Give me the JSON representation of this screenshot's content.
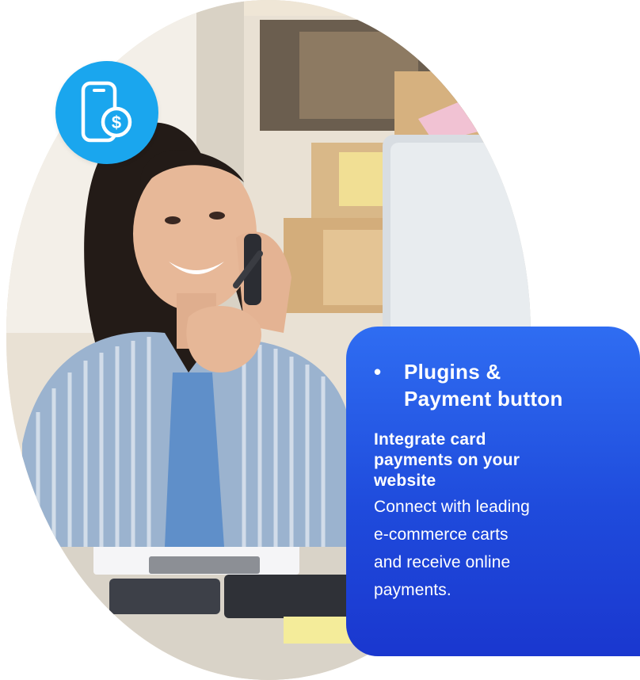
{
  "hero": {
    "image_description_icon": "woman-on-phone-photo",
    "badge_icon": "phone-payment-icon"
  },
  "card": {
    "bullet": "•",
    "title_line1": "Plugins &",
    "title_line2": "Payment button",
    "subtitle_line1": "Integrate card",
    "subtitle_line2": "payments on your",
    "subtitle_line3": "website",
    "body_line1": "Connect with leading",
    "body_line2": "e-commerce carts",
    "body_line3": "and receive online",
    "body_line4": "payments."
  },
  "colors": {
    "badge": "#1aa6ee",
    "card_top": "#2f6df2",
    "card_bottom": "#1a37cf",
    "text": "#ffffff"
  }
}
